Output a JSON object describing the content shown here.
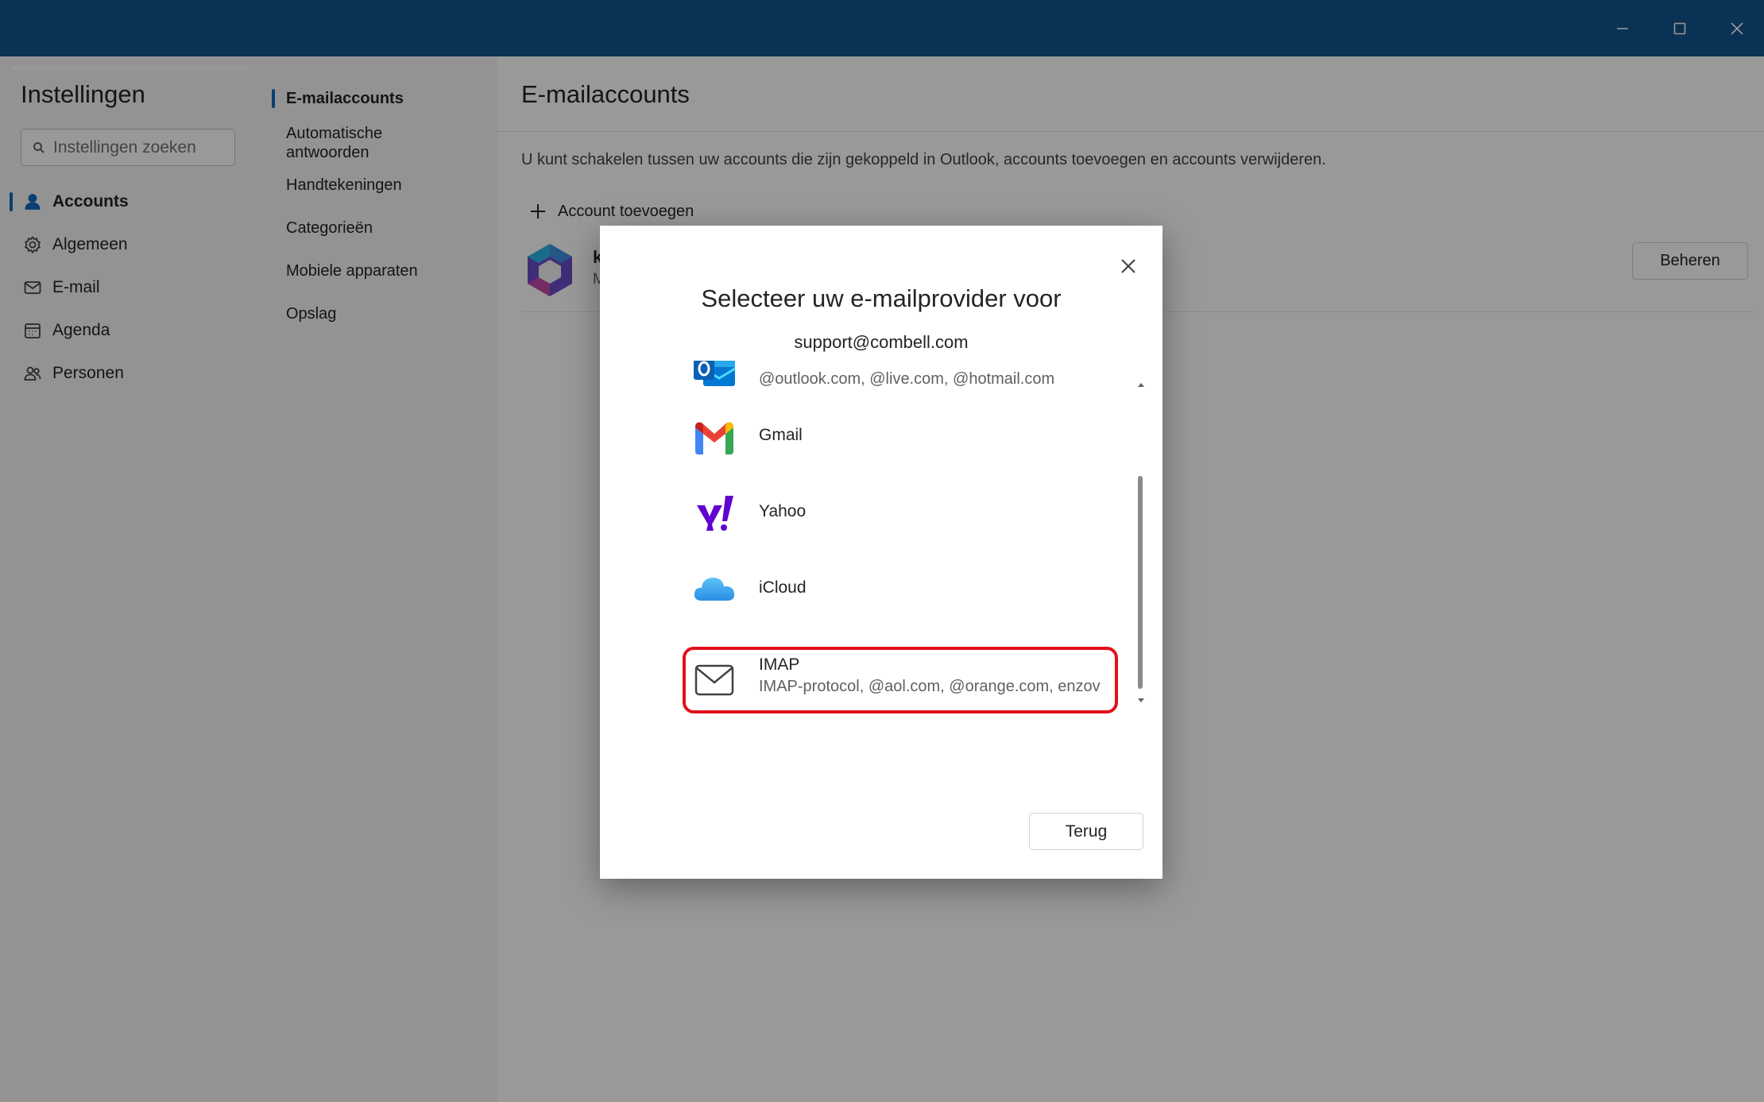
{
  "window": {
    "controls": {
      "minimize_icon": "minimize-icon",
      "maximize_icon": "maximize-icon",
      "close_icon": "close-icon"
    },
    "titlebar_color": "#0f548c"
  },
  "settings": {
    "title": "Instellingen",
    "search_placeholder": "Instellingen zoeken",
    "nav": [
      {
        "label": "Accounts",
        "icon": "person-icon",
        "active": true
      },
      {
        "label": "Algemeen",
        "icon": "gear-icon",
        "active": false
      },
      {
        "label": "E-mail",
        "icon": "mail-icon",
        "active": false
      },
      {
        "label": "Agenda",
        "icon": "calendar-icon",
        "active": false
      },
      {
        "label": "Personen",
        "icon": "people-icon",
        "active": false
      }
    ],
    "subnav": [
      {
        "label": "E-mailaccounts",
        "active": true
      },
      {
        "label": "Automatische antwoorden",
        "active": false
      },
      {
        "label": "Handtekeningen",
        "active": false
      },
      {
        "label": "Categorieën",
        "active": false
      },
      {
        "label": "Mobiele apparaten",
        "active": false
      },
      {
        "label": "Opslag",
        "active": false
      }
    ]
  },
  "main": {
    "title": "E-mailaccounts",
    "description": "U kunt schakelen tussen uw accounts die zijn gekoppeld in Outlook, accounts toevoegen en accounts verwijderen.",
    "add_account_label": "Account toevoegen",
    "account": {
      "name_visible": "k",
      "sub_visible": "M"
    },
    "manage_label": "Beheren"
  },
  "dialog": {
    "title": "Selecteer uw e-mailprovider voor",
    "email": "support@combell.com",
    "providers": [
      {
        "name": "",
        "description": "@outlook.com, @live.com, @hotmail.com",
        "icon": "outlook-icon"
      },
      {
        "name": "Gmail",
        "description": "",
        "icon": "gmail-icon"
      },
      {
        "name": "Yahoo",
        "description": "",
        "icon": "yahoo-icon"
      },
      {
        "name": "iCloud",
        "description": "",
        "icon": "icloud-icon"
      },
      {
        "name": "IMAP",
        "description": "IMAP-protocol, @aol.com, @orange.com, enzovoort",
        "icon": "envelope-icon",
        "highlighted": true
      }
    ],
    "back_label": "Terug",
    "highlight_color": "#e3101c"
  }
}
